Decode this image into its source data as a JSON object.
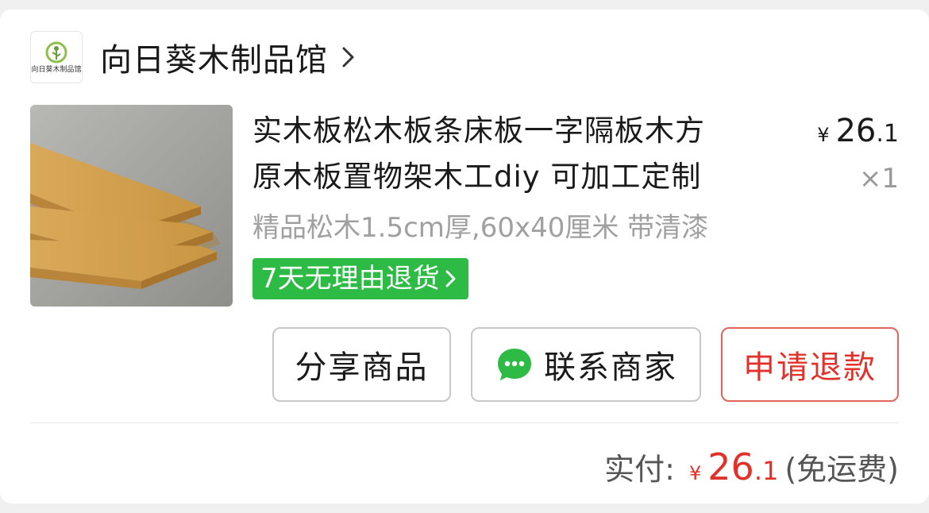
{
  "store": {
    "logo_text": "向日葵木制品馆",
    "name": "向日葵木制品馆"
  },
  "product": {
    "title_line1": "实木板松木板条床板一字隔板木方",
    "title_line2": "原木板置物架木工diy 可加工定制",
    "spec": "精品松木1.5cm厚,60x40厘米 带清漆",
    "price_symbol": "¥",
    "price_int": "26",
    "price_dec": ".1",
    "quantity": "×1",
    "return_tag": "7天无理由退货"
  },
  "actions": {
    "share_label": "分享商品",
    "contact_label": "联系商家",
    "refund_label": "申请退款"
  },
  "payment": {
    "label": "实付:",
    "symbol": "¥",
    "amount_int": "26",
    "amount_dec": ".1",
    "note": "(免运费)"
  },
  "colors": {
    "accent_red": "#e0312a",
    "tag_green": "#2dbb46",
    "wechat_green": "#2dbb46"
  },
  "icons": [
    "chevron-right-icon",
    "chat-bubble-icon",
    "tag-chevron-icon"
  ]
}
